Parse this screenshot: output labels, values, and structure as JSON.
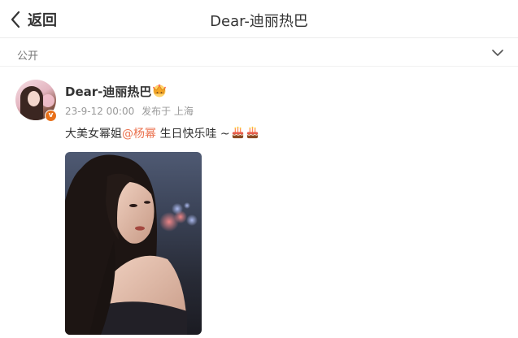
{
  "header": {
    "back_label": "返回",
    "title": "Dear-迪丽热巴"
  },
  "visibility": {
    "label": "公开",
    "chevron_icon": "chevron-down-icon"
  },
  "post": {
    "username": "Dear-迪丽热巴",
    "verified_badge": "v",
    "crown_icon": "crown-icon",
    "date": "23-9-12 00:00",
    "location": "发布于 上海",
    "text_before": "大美女幂姐",
    "mention": "@杨幂",
    "text_after": " 生日快乐哇 ~",
    "emojis": [
      "cake-emoji",
      "cake-emoji"
    ],
    "colors": {
      "mention": "#eb7350",
      "badge": "#e8701a",
      "meta": "#999999"
    }
  }
}
